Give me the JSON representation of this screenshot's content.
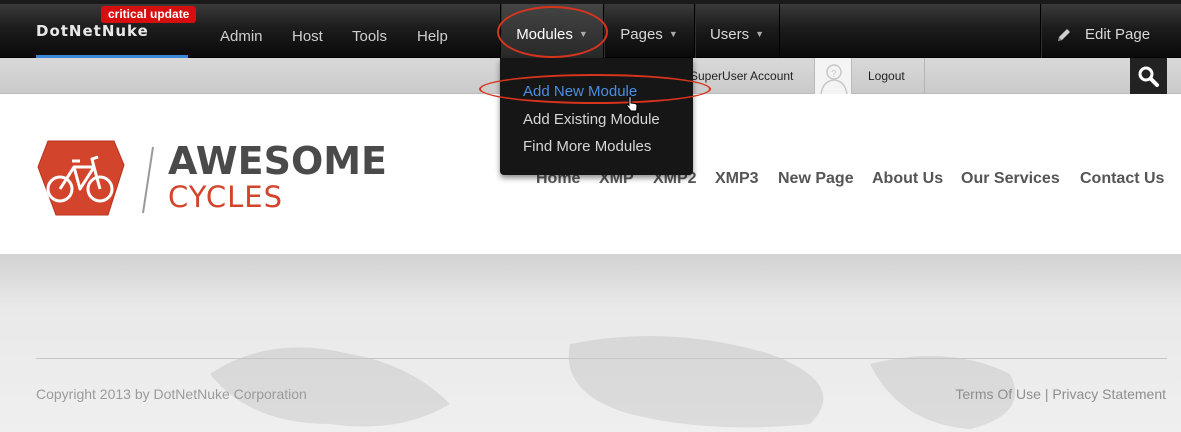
{
  "controlbar": {
    "brand": "DotNetNuke",
    "critical_badge": "critical update",
    "menus": [
      "Admin",
      "Host",
      "Tools",
      "Help"
    ],
    "tabs": [
      "Modules",
      "Pages",
      "Users"
    ],
    "edit_page": "Edit Page"
  },
  "userbar": {
    "account": "SuperUser Account",
    "logout": "Logout"
  },
  "dropdown": {
    "items": [
      "Add New Module",
      "Add Existing Module",
      "Find More Modules"
    ]
  },
  "site": {
    "logo_line1": "AWESOME",
    "logo_line2": "CYCLES",
    "nav": [
      "Home",
      "XMP",
      "XMP2",
      "XMP3",
      "New Page",
      "About Us",
      "Our Services",
      "Contact Us"
    ]
  },
  "footer": {
    "copyright": "Copyright 2013 by DotNetNuke Corporation",
    "terms": "Terms Of Use",
    "divider": "|",
    "privacy": "Privacy Statement"
  },
  "colors": {
    "accent_blue": "#3d87d8",
    "critical_red": "#d60e0e",
    "logo_red": "#d3442c",
    "annotation_red": "#d7341e"
  }
}
